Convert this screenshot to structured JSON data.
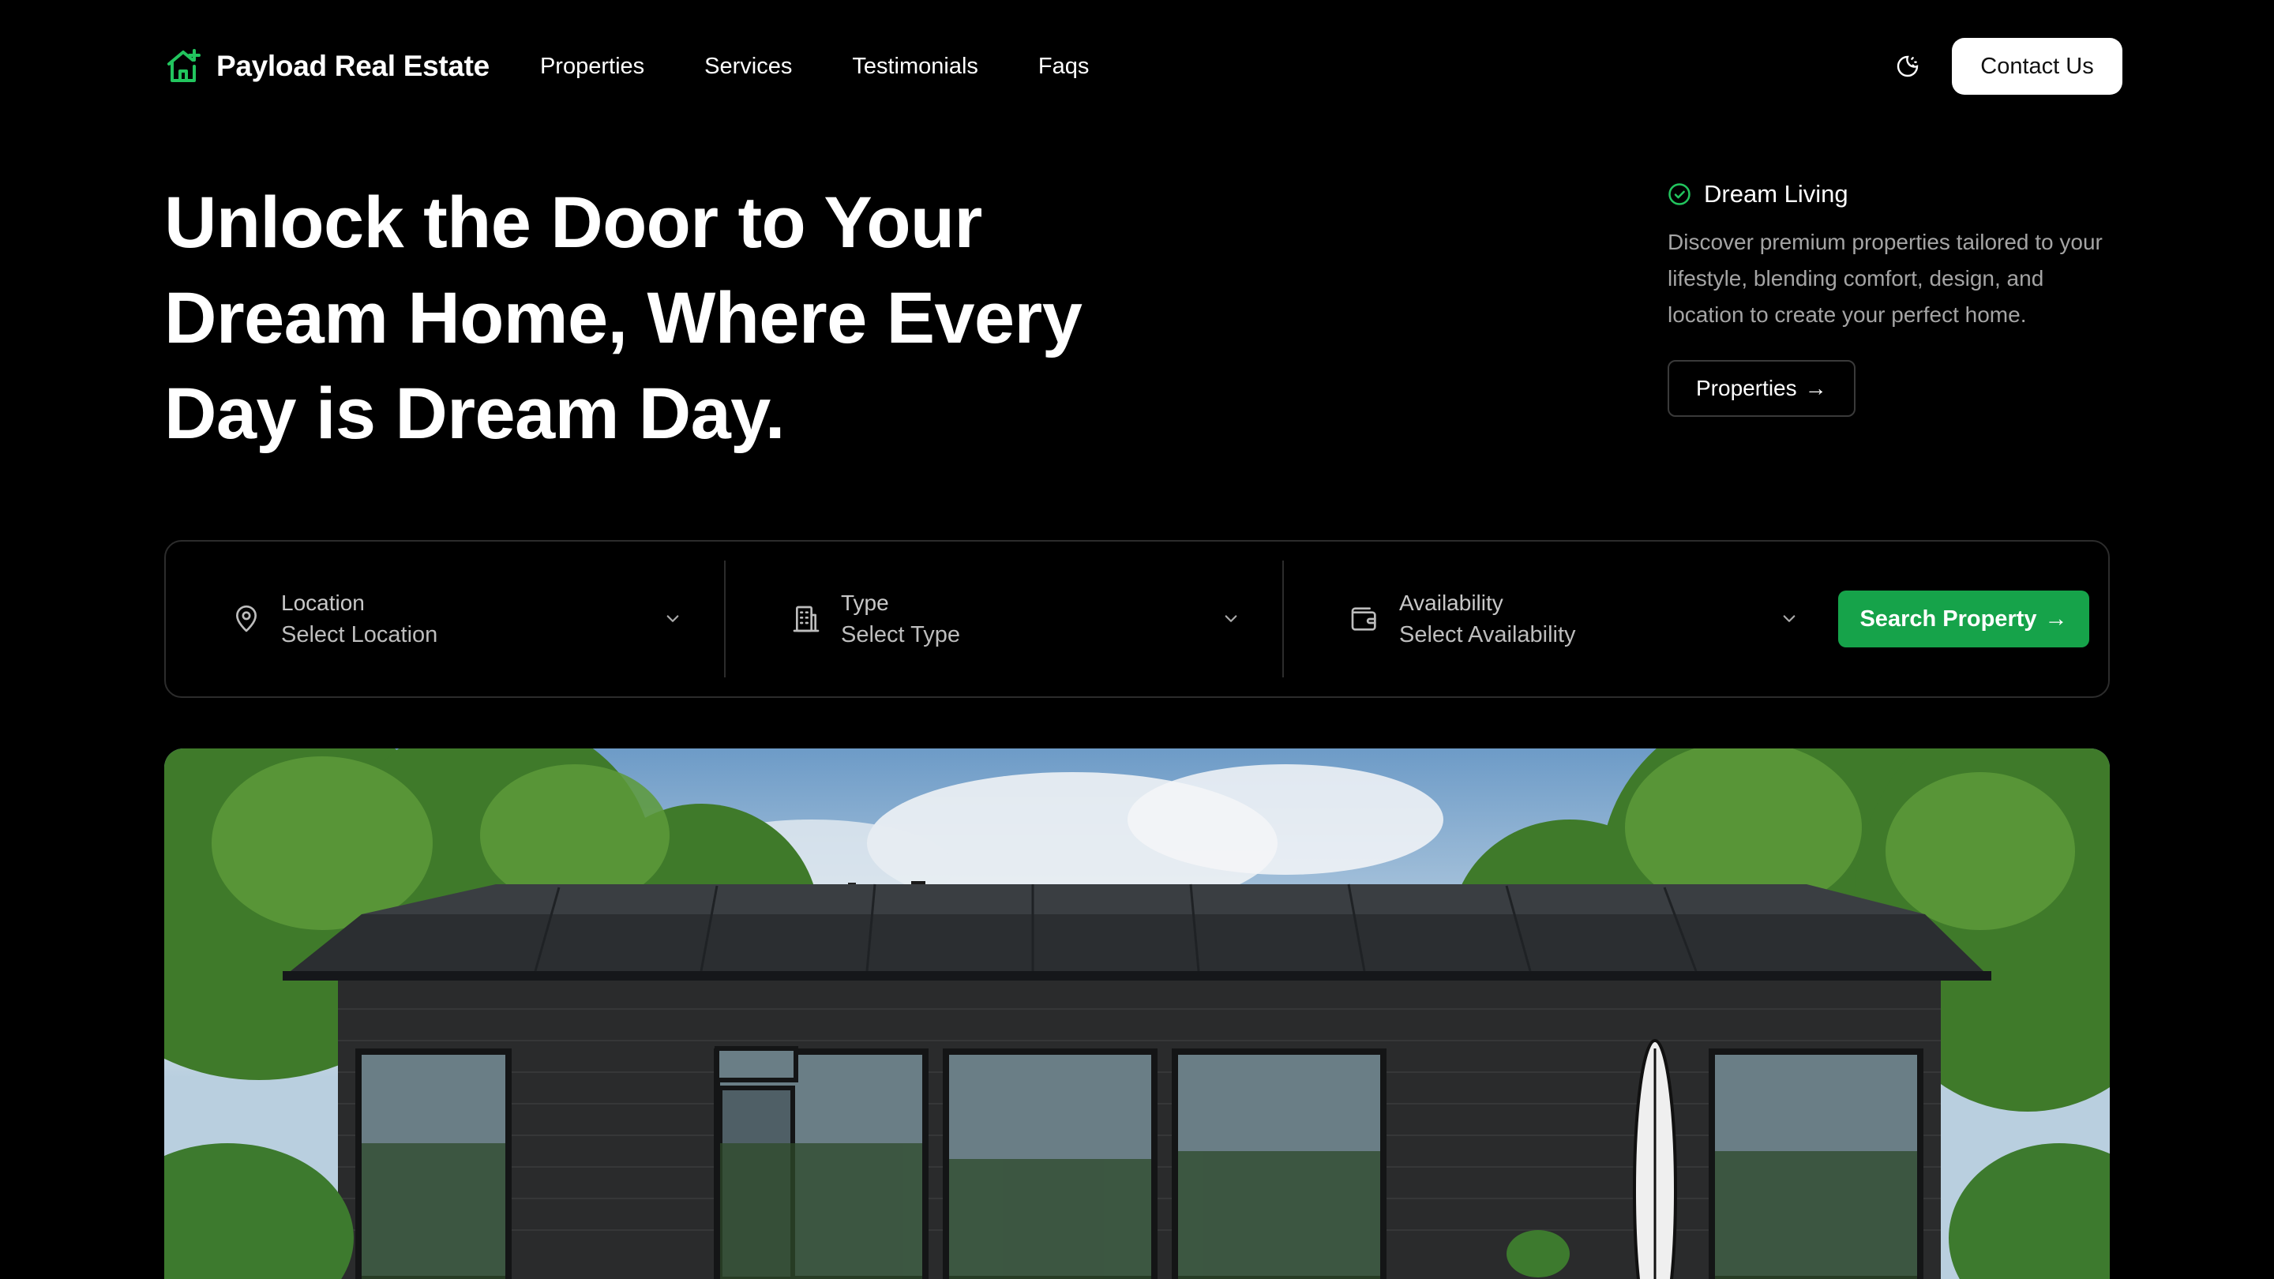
{
  "brand": {
    "name": "Payload Real Estate",
    "icon": "house-plus-icon",
    "accent": "#22c55e"
  },
  "nav": {
    "links": [
      "Properties",
      "Services",
      "Testimonials",
      "Faqs"
    ],
    "theme_icon": "moon-sun-icon",
    "contact_label": "Contact Us"
  },
  "hero": {
    "title": "Unlock the Door to Your Dream Home, Where Every Day is Dream Day.",
    "aside_title": "Dream Living",
    "aside_desc": "Discover premium properties tailored to your lifestyle, blending comfort, design, and location to create your perfect home.",
    "aside_button": "Properties",
    "arrow": "→"
  },
  "search": {
    "fields": [
      {
        "label": "Location",
        "value": "Select Location",
        "icon": "map-pin-icon"
      },
      {
        "label": "Type",
        "value": "Select Type",
        "icon": "building-icon"
      },
      {
        "label": "Availability",
        "value": "Select Availability",
        "icon": "wallet-icon"
      }
    ],
    "button": "Search Property",
    "button_color": "#16a34a"
  },
  "image": {
    "subject": "modern-black-house-photo"
  }
}
